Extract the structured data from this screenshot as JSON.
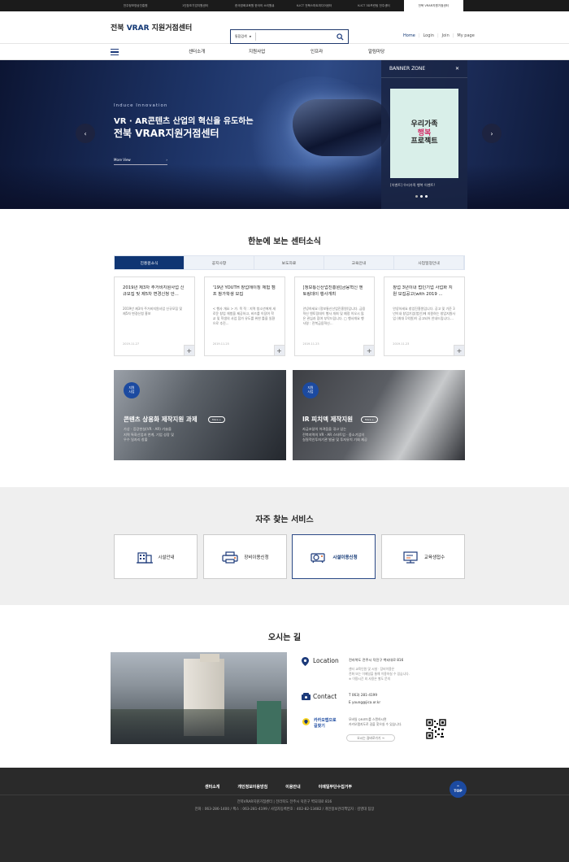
{
  "topbar": [
    "전주정보영상진흥원",
    "1인창조기업지원센터",
    "한국영화교육원 한국의 소리원큐",
    "K-ICT 전북스마트미디어센터",
    "K-ICT 3D프린팅 전주센터",
    "전북 VRAR지원거점센터"
  ],
  "header": {
    "logo_pre": "전북 ",
    "logo_strong": "VRAR",
    "logo_post": " 지원거점센터",
    "search_select": "통합검색",
    "links": [
      "Home",
      "Login",
      "Join",
      "My page"
    ]
  },
  "gnb": [
    "센터소개",
    "지원사업",
    "인프라",
    "알림마당"
  ],
  "hero": {
    "sub": "Induce Innovation",
    "line1": "VR · AR콘텐츠 산업의 혁신을 유도하는",
    "line2": "전북 VRAR지원거점센터",
    "more": "More View",
    "prev": "‹",
    "next": "›"
  },
  "banner": {
    "title": "BANNER ZONE",
    "close": "✕",
    "poster1": "우리가족",
    "poster2": "행복",
    "poster3": "프로젝트",
    "caption": "[이벤트] 우리가족 행복 이벤트!"
  },
  "news": {
    "title": "한눈에 보는 센터소식",
    "tabs": [
      "진흥원소식",
      "공지사항",
      "보도자료",
      "교육안내",
      "사업일정안내"
    ],
    "cards": [
      {
        "title": "2019년 제3차 주거비지원사업 신규모집 및 제5차 변경신청 안...",
        "desc": "2019년 제3차 주거비지원사업 신규모집 및 제5차 변경신청 홍보",
        "date": "2019.11.27"
      },
      {
        "title": "'19년 YOUTH 창업에이징 체험 캠프 참가학생 모집",
        "desc": "< 행사 개요 > 가. 목 적 : 지역 청소년에게 새로운 창업 체험을 제공하고, 비즈를 이장여 학교 및 학생의 사업 참가 유도를 위한 틀을 일환으로 추진...",
        "date": "2019.11.25"
      },
      {
        "title": "[정보통신산업진흥원]금융혁신 엔토링데이 행사개최",
        "desc": "안녕하세요 (정보통신산업진흥원)입니다. 금융혁신 엔토링데이 행사 개최 및 예정 이오시 많은 관심과 참여 부탁드립니다. □ 행사개요 행사명 : 전북금융혁신...",
        "date": "2019.11.23"
      },
      {
        "title": "창업 3년이내 법인기업 사업화 지원 모집공고(with 2019 ...",
        "desc": "안녕하세요 창업진흥원입니다. 공고 및 기준 3년이내 창업기업(법인)에 지원하는 창업지원사업 (최대 1억원)이 공고되어 안내드립니다....",
        "date": "2019.11.23"
      }
    ]
  },
  "biz": [
    {
      "badge1": "지원",
      "badge2": "사업",
      "title": "콘텐츠 상용화 제작지원 과제",
      "more": "More +",
      "d1": "가상 · 증강현실(VR · AR) 기술을",
      "d2": "지역 특화산업과 연계, 기업 성장 및",
      "d3": "우수 일자리 창출"
    },
    {
      "badge1": "지원",
      "badge2": "사업",
      "title": "IR 피치덱 제작지원",
      "more": "More +",
      "d1": "자금조달의 어려움을 겪고 있는",
      "d2": "전북지역의 VR · AR 스타트업 · 중소기업의",
      "d3": "실질적인투자기관 발굴 및 투자유치 기회 제공"
    }
  ],
  "services": {
    "title": "자주 찾는 서비스",
    "items": [
      "시설안내",
      "장비이용신청",
      "시설이용신청",
      "교육생접수"
    ]
  },
  "location": {
    "title": "오시는 길",
    "loc_label": "Location",
    "loc_addr": "전라북도 전주시 덕진구 벽되대로 816",
    "loc_n1": "센터 교육인원 및 시설 · 장비이용은",
    "loc_n2": "전화 또는 이메일을 통해 이용하실 수 있습니다.",
    "loc_n3": "※ 이용시간 외 사용은 별도 문의",
    "contact_label": "Contact",
    "tel": "T 063) 281-4199",
    "email": "E young@jica.or.kr",
    "kakao1": "카카오맵으로",
    "kakao2": "길찾기",
    "qr1": "모바일 QR코드를 스캔하시면",
    "qr2": "카카오맵지도로 길을 찾으실 수 있습니다.",
    "btn": "오시는 길바로가기 →"
  },
  "footer": {
    "links": [
      "센터소개",
      "개인정보이용방침",
      "이용안내",
      "이메일무단수집거부"
    ],
    "addr1": "전북VRAR지원거점센터 | 전라북도 전주시 덕진구 벽되대로 816",
    "addr2": "전화 : 063-286-1400 / 팩스 : 063-281-4199 / 사업자등록번호 : 402-82-13482 / 개인정보관리책임자 : 김영대 팀장",
    "top": "TOP"
  }
}
